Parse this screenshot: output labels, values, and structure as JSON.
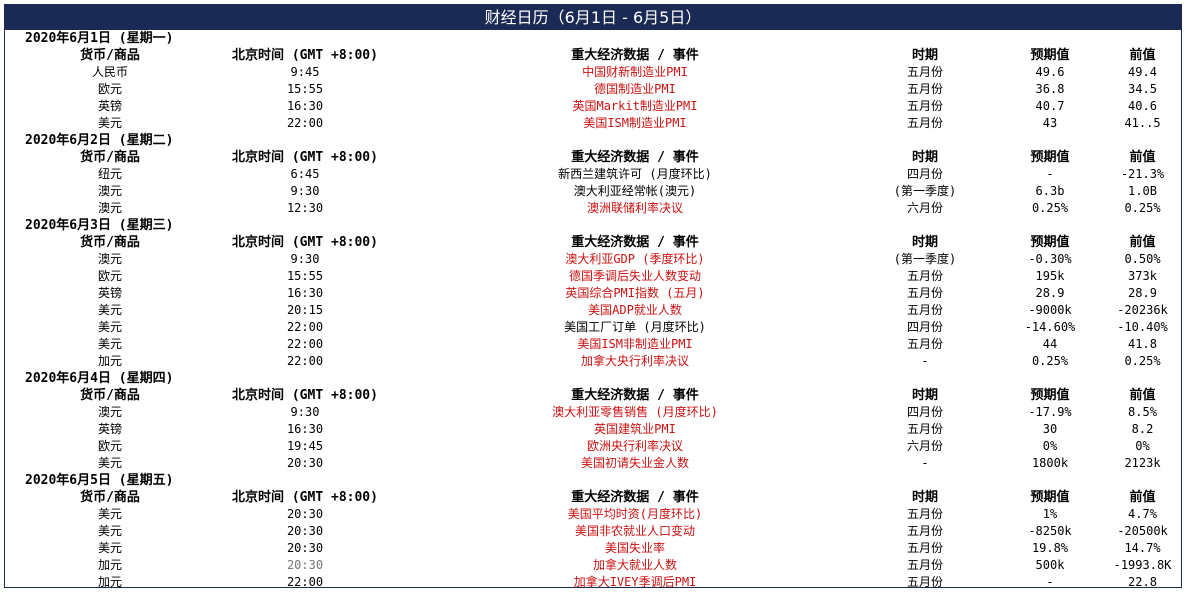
{
  "title": "财经日历（6月1日 - 6月5日）",
  "headers": {
    "currency": "货币/商品",
    "time": "北京时间 (GMT +8:00)",
    "event": "重大经济数据 / 事件",
    "period": "时期",
    "forecast": "预期值",
    "previous": "前值"
  },
  "days": [
    {
      "date": "2020年6月1日 (星期一)",
      "rows": [
        {
          "cur": "人民币",
          "time": "9:45",
          "event": "中国财新制造业PMI",
          "red": true,
          "period": "五月份",
          "fc": "49.6",
          "prev": "49.4"
        },
        {
          "cur": "欧元",
          "time": "15:55",
          "event": "德国制造业PMI",
          "red": true,
          "period": "五月份",
          "fc": "36.8",
          "prev": "34.5"
        },
        {
          "cur": "英镑",
          "time": "16:30",
          "event": "英国Markit制造业PMI",
          "red": true,
          "period": "五月份",
          "fc": "40.7",
          "prev": "40.6"
        },
        {
          "cur": "美元",
          "time": "22:00",
          "event": "美国ISM制造业PMI",
          "red": true,
          "period": "五月份",
          "fc": "43",
          "prev": "41..5"
        }
      ]
    },
    {
      "date": "2020年6月2日 (星期二)",
      "rows": [
        {
          "cur": "纽元",
          "time": "6:45",
          "event": "新西兰建筑许可 (月度环比)",
          "red": false,
          "period": "四月份",
          "fc": "-",
          "prev": "-21.3%"
        },
        {
          "cur": "澳元",
          "time": "9:30",
          "event": "澳大利亚经常帐(澳元)",
          "red": false,
          "period": "(第一季度)",
          "fc": "6.3b",
          "prev": "1.0B"
        },
        {
          "cur": "澳元",
          "time": "12:30",
          "event": "澳洲联储利率决议",
          "red": true,
          "period": "六月份",
          "fc": "0.25%",
          "prev": "0.25%"
        }
      ]
    },
    {
      "date": "2020年6月3日 (星期三)",
      "rows": [
        {
          "cur": "澳元",
          "time": "9:30",
          "event": "澳大利亚GDP (季度环比)",
          "red": true,
          "period": "(第一季度)",
          "fc": "-0.30%",
          "prev": "0.50%"
        },
        {
          "cur": "欧元",
          "time": "15:55",
          "event": "德国季调后失业人数变动",
          "red": true,
          "period": "五月份",
          "fc": "195k",
          "prev": "373k"
        },
        {
          "cur": "英镑",
          "time": "16:30",
          "event": "英国综合PMI指数 (五月)",
          "red": true,
          "period": "五月份",
          "fc": "28.9",
          "prev": "28.9"
        },
        {
          "cur": "美元",
          "time": "20:15",
          "event": "美国ADP就业人数",
          "red": true,
          "period": "五月份",
          "fc": "-9000k",
          "prev": "-20236k"
        },
        {
          "cur": "美元",
          "time": "22:00",
          "event": "美国工厂订单 (月度环比)",
          "red": false,
          "period": "四月份",
          "fc": "-14.60%",
          "prev": "-10.40%"
        },
        {
          "cur": "美元",
          "time": "22:00",
          "event": "美国ISM非制造业PMI",
          "red": true,
          "period": "五月份",
          "fc": "44",
          "prev": "41.8"
        },
        {
          "cur": "加元",
          "time": "22:00",
          "event": "加拿大央行利率决议",
          "red": true,
          "period": "-",
          "fc": "0.25%",
          "prev": "0.25%"
        }
      ]
    },
    {
      "date": "2020年6月4日 (星期四)",
      "rows": [
        {
          "cur": "澳元",
          "time": "9:30",
          "event": "澳大利亚零售销售 (月度环比)",
          "red": true,
          "period": "四月份",
          "fc": "-17.9%",
          "prev": "8.5%"
        },
        {
          "cur": "英镑",
          "time": "16:30",
          "event": "英国建筑业PMI",
          "red": true,
          "period": "五月份",
          "fc": "30",
          "prev": "8.2"
        },
        {
          "cur": "欧元",
          "time": "19:45",
          "event": "欧洲央行利率决议",
          "red": true,
          "period": "六月份",
          "fc": "0%",
          "prev": "0%"
        },
        {
          "cur": "美元",
          "time": "20:30",
          "event": "美国初请失业金人数",
          "red": true,
          "period": "-",
          "fc": "1800k",
          "prev": "2123k"
        }
      ]
    },
    {
      "date": "2020年6月5日 (星期五)",
      "rows": [
        {
          "cur": "美元",
          "time": "20:30",
          "event": "美国平均时资(月度环比)",
          "red": true,
          "period": "五月份",
          "fc": "1%",
          "prev": "4.7%"
        },
        {
          "cur": "美元",
          "time": "20:30",
          "event": "美国非农就业人口变动",
          "red": true,
          "period": "五月份",
          "fc": "-8250k",
          "prev": "-20500k"
        },
        {
          "cur": "美元",
          "time": "20:30",
          "event": "美国失业率",
          "red": true,
          "period": "五月份",
          "fc": "19.8%",
          "prev": "14.7%"
        },
        {
          "cur": "加元",
          "time": "20:30",
          "event": "加拿大就业人数",
          "red": true,
          "period": "五月份",
          "fc": "500k",
          "prev": "-1993.8K",
          "time_grey": true
        },
        {
          "cur": "加元",
          "time": "22:00",
          "event": "加拿大IVEY季调后PMI",
          "red": true,
          "period": "五月份",
          "fc": "-",
          "prev": "22.8"
        }
      ]
    }
  ]
}
